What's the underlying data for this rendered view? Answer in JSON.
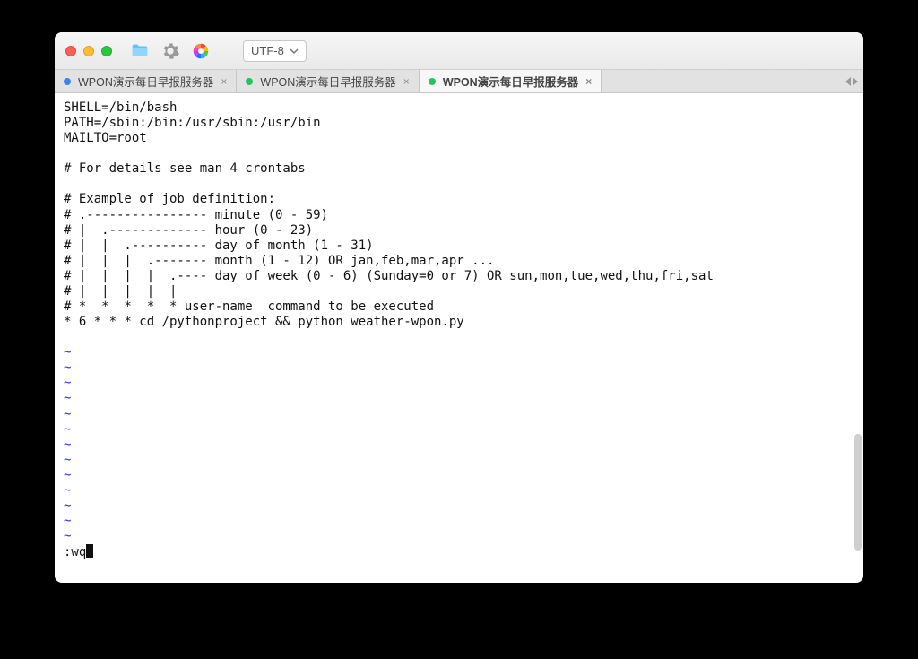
{
  "titlebar": {
    "encoding_label": "UTF-8",
    "icons": {
      "close": "close-icon",
      "minimize": "minimize-icon",
      "zoom": "zoom-icon",
      "folder": "folder-icon",
      "gear": "gear-icon",
      "color": "color-wheel-icon"
    }
  },
  "tabs": [
    {
      "label": "WPON演示每日早报服务器",
      "color": "blue",
      "active": false
    },
    {
      "label": "WPON演示每日早报服务器",
      "color": "green",
      "active": false
    },
    {
      "label": "WPON演示每日早报服务器",
      "color": "green",
      "active": true
    }
  ],
  "editor": {
    "lines": [
      "SHELL=/bin/bash",
      "PATH=/sbin:/bin:/usr/sbin:/usr/bin",
      "MAILTO=root",
      "",
      "# For details see man 4 crontabs",
      "",
      "# Example of job definition:",
      "# .---------------- minute (0 - 59)",
      "# |  .------------- hour (0 - 23)",
      "# |  |  .---------- day of month (1 - 31)",
      "# |  |  |  .------- month (1 - 12) OR jan,feb,mar,apr ...",
      "# |  |  |  |  .---- day of week (0 - 6) (Sunday=0 or 7) OR sun,mon,tue,wed,thu,fri,sat",
      "# |  |  |  |  |",
      "# *  *  *  *  * user-name  command to be executed",
      "* 6 * * * cd /pythonproject && python weather-wpon.py"
    ],
    "tilde_rows": 13,
    "command": ":wq"
  }
}
